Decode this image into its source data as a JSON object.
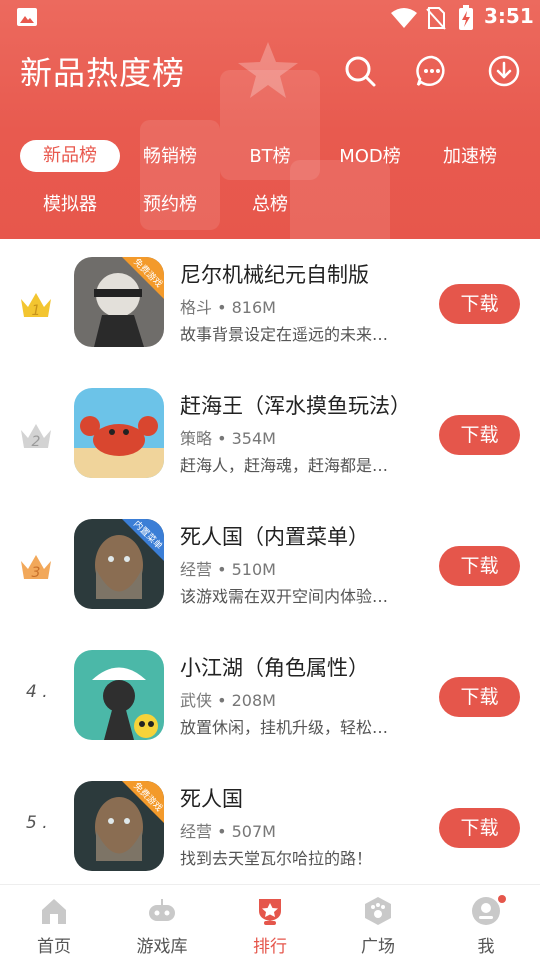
{
  "status_bar": {
    "time": "3:51"
  },
  "header": {
    "title": "新品热度榜"
  },
  "tabs": [
    {
      "label": "新品榜",
      "active": true
    },
    {
      "label": "畅销榜"
    },
    {
      "label": "BT榜"
    },
    {
      "label": "MOD榜"
    },
    {
      "label": "加速榜"
    },
    {
      "label": "模拟器"
    },
    {
      "label": "预约榜"
    },
    {
      "label": "总榜"
    }
  ],
  "items": [
    {
      "rank": "1",
      "title": "尼尔机械纪元自制版",
      "meta": "格斗 • 816M",
      "desc": "故事背景设定在遥远的未来…",
      "badge": "免费游戏",
      "button": "下载"
    },
    {
      "rank": "2",
      "title": "赶海王（浑水摸鱼玩法）",
      "meta": "策略 • 354M",
      "desc": "赶海人，赶海魂，赶海都是…",
      "badge": "",
      "button": "下载"
    },
    {
      "rank": "3",
      "title": "死人国（内置菜单）",
      "meta": "经营 • 510M",
      "desc": "该游戏需在双开空间内体验…",
      "badge": "内置菜单",
      "button": "下载"
    },
    {
      "rank": "4 .",
      "title": "小江湖（角色属性）",
      "meta": "武侠 • 208M",
      "desc": "放置休闲，挂机升级，轻松…",
      "badge": "",
      "button": "下载"
    },
    {
      "rank": "5 .",
      "title": "死人国",
      "meta": "经营 • 507M",
      "desc": "找到去天堂瓦尔哈拉的路！",
      "badge": "免费游戏",
      "button": "下载"
    }
  ],
  "bottom_nav": [
    {
      "label": "首页",
      "icon": "home-icon"
    },
    {
      "label": "游戏库",
      "icon": "gamepad-icon"
    },
    {
      "label": "排行",
      "icon": "ranking-icon",
      "active": true
    },
    {
      "label": "广场",
      "icon": "plaza-icon"
    },
    {
      "label": "我",
      "icon": "profile-icon"
    }
  ],
  "colors": {
    "accent": "#e5564b",
    "header_bg": "#ea6256"
  }
}
